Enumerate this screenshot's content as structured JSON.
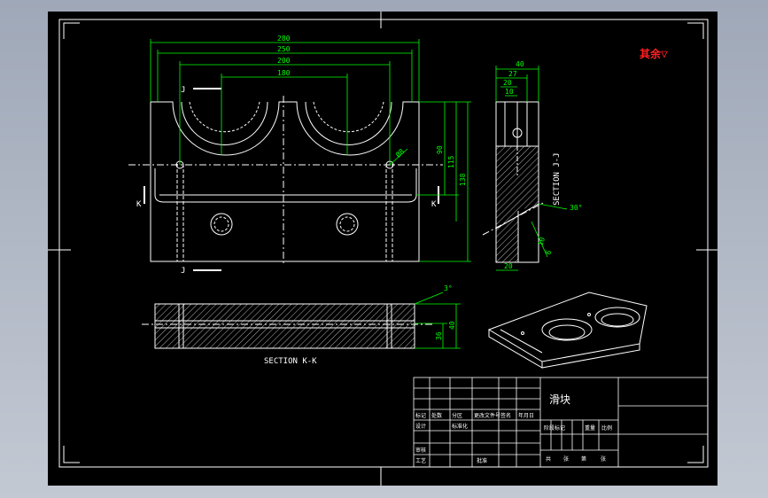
{
  "colors": {
    "background": "#000000",
    "viewport": "#aeb6c4",
    "frame": "#ffffff",
    "part": "#ffffff",
    "dimension": "#00ff00",
    "hatch": "#ffffff",
    "roughness_mark": "#ff2020"
  },
  "drawing": {
    "roughness_note": "其余",
    "roughness_symbol": "▽",
    "front_view": {
      "dims": {
        "width_total": "280",
        "width_outer": "250",
        "width_mid": "200",
        "width_inner": "180",
        "height_a": "90",
        "height_b": "115",
        "height_total": "138",
        "hole_dia": "Ø8"
      },
      "section_marks": {
        "k_left": "K",
        "k_right": "K",
        "j_top": "J",
        "j_bottom": "J"
      }
    },
    "side_view": {
      "section_label": "SECTION J-J",
      "dims": {
        "top": "40",
        "d27": "27",
        "d20a": "20",
        "d10": "10",
        "angle": "30°",
        "d10b": "10",
        "d6": "6",
        "bottom": "20"
      }
    },
    "bottom_view": {
      "section_label": "SECTION K-K",
      "dims": {
        "angle": "3°",
        "d40": "40",
        "d36": "36"
      }
    }
  },
  "title_block": {
    "part_name": "滑块",
    "header_labels": [
      "标记",
      "处数",
      "分区",
      "更改文件号",
      "签名",
      "年月日"
    ],
    "row_design": [
      "设计",
      "",
      "标准化",
      "",
      "",
      ""
    ],
    "row_review": [
      "审核",
      "",
      "",
      "",
      "",
      ""
    ],
    "row_process": [
      "工艺",
      "",
      "批准",
      "",
      "",
      ""
    ],
    "stage_labels": [
      "阶段标记",
      "重量",
      "比例"
    ],
    "sheet_labels": [
      "共",
      "张",
      "第",
      "张"
    ]
  }
}
